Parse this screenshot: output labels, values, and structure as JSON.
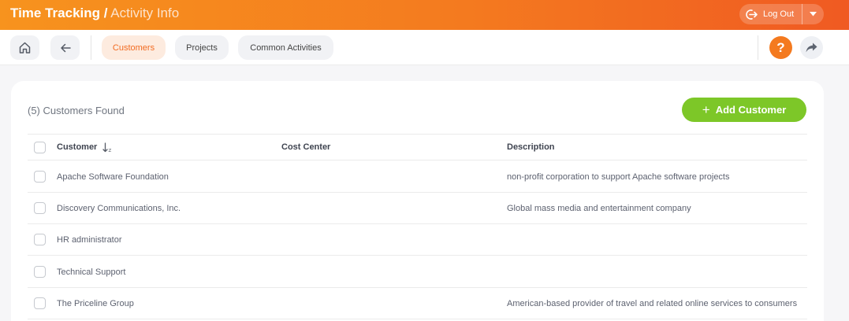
{
  "header": {
    "title_main": "Time Tracking /",
    "title_sub": " Activity Info",
    "logout_label": "Log Out"
  },
  "nav": {
    "tabs": [
      {
        "label": "Customers",
        "active": true
      },
      {
        "label": "Projects",
        "active": false
      },
      {
        "label": "Common Activities",
        "active": false
      }
    ],
    "help_label": "?"
  },
  "content": {
    "count_label": "(5) Customers Found",
    "add_button_label": "Add Customer",
    "columns": [
      "Customer",
      "Cost Center",
      "Description"
    ],
    "rows": [
      {
        "customer": "Apache Software Foundation",
        "cost_center": "",
        "description": "non-profit corporation to support Apache software projects"
      },
      {
        "customer": "Discovery Communications, Inc.",
        "cost_center": "",
        "description": "Global mass media and entertainment company"
      },
      {
        "customer": "HR administrator",
        "cost_center": "",
        "description": ""
      },
      {
        "customer": "Technical Support",
        "cost_center": "",
        "description": ""
      },
      {
        "customer": "The Priceline Group",
        "cost_center": "",
        "description": "American-based provider of travel and related online services to consumers"
      }
    ]
  },
  "colors": {
    "header_orange": "#f47a1f",
    "active_tab_text": "#f26c22",
    "add_button_green": "#7dc728"
  },
  "icons": {
    "home": "home-icon",
    "back": "arrow-left-icon",
    "logout": "logout-icon",
    "caret": "caret-down-icon",
    "help": "question-icon",
    "share": "share-icon",
    "sort": "sort-az-icon",
    "add": "plus-icon"
  }
}
